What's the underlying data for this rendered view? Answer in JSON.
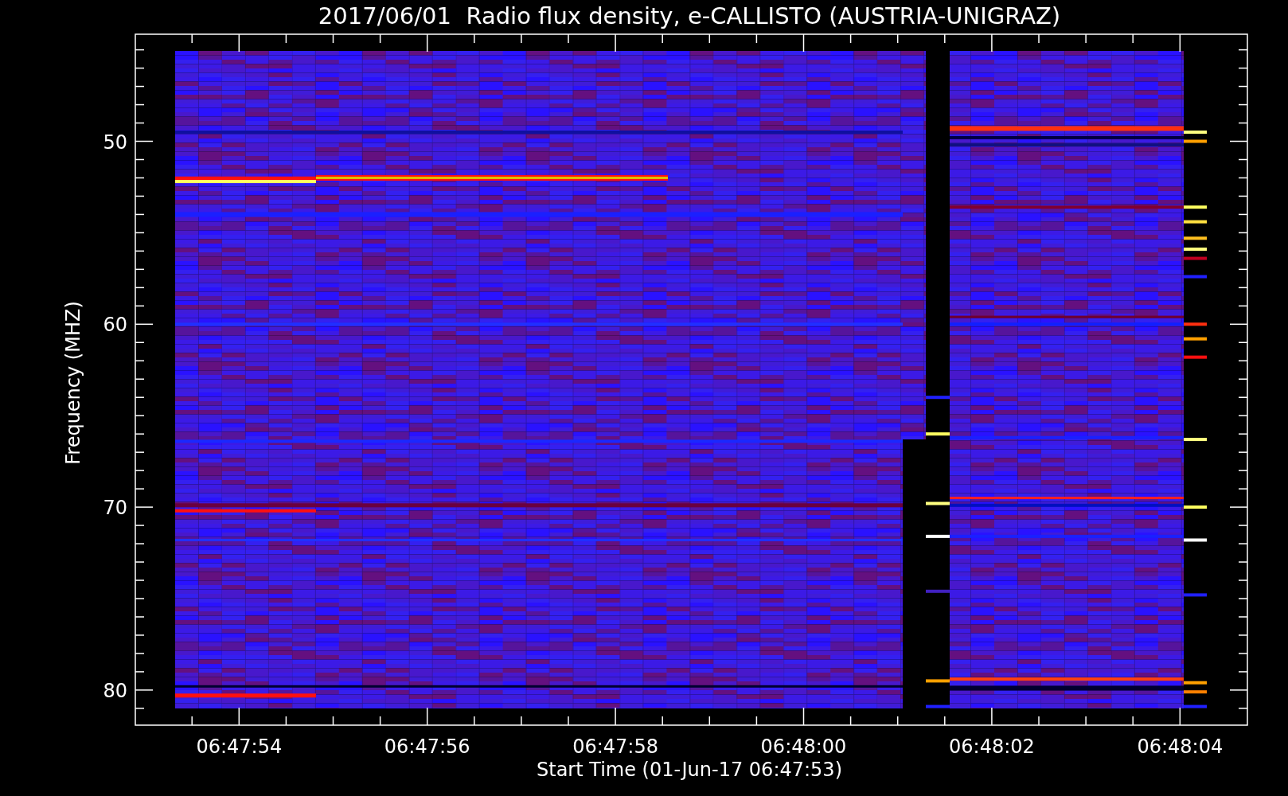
{
  "title": "2017/06/01  Radio flux density, e-CALLISTO (AUSTRIA-UNIGRAZ)",
  "y_axis": {
    "label": "Frequency (MHZ)",
    "ticks": [
      "50",
      "60",
      "70",
      "80"
    ]
  },
  "x_axis": {
    "label": "Start Time (01-Jun-17 06:47:53)",
    "ticks": [
      "06:47:54",
      "06:47:56",
      "06:47:58",
      "06:48:00",
      "06:48:02",
      "06:48:04"
    ]
  }
}
